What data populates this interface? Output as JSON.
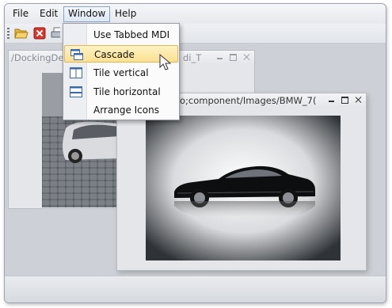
{
  "menubar": {
    "items": [
      {
        "label": "File"
      },
      {
        "label": "Edit"
      },
      {
        "label": "Window"
      },
      {
        "label": "Help"
      }
    ]
  },
  "window_menu": {
    "items": [
      {
        "label": "Use Tabbed MDI",
        "icon": "none"
      },
      {
        "label": "Cascade",
        "icon": "cascade-icon",
        "highlighted": true
      },
      {
        "label": "Tile vertical",
        "icon": "tile-vertical-icon"
      },
      {
        "label": "Tile horizontal",
        "icon": "tile-horizontal-icon"
      },
      {
        "label": "Arrange Icons",
        "icon": "none"
      }
    ]
  },
  "child_windows": [
    {
      "title": "/DockingDe",
      "title_tail": "di_T",
      "active": false
    },
    {
      "title": "o;component/Images/BMW_7(",
      "active": true
    }
  ],
  "colors": {
    "highlight": "#fbe08f",
    "highlight_border": "#e2b659",
    "menu_active_border": "#8ba3c4"
  }
}
